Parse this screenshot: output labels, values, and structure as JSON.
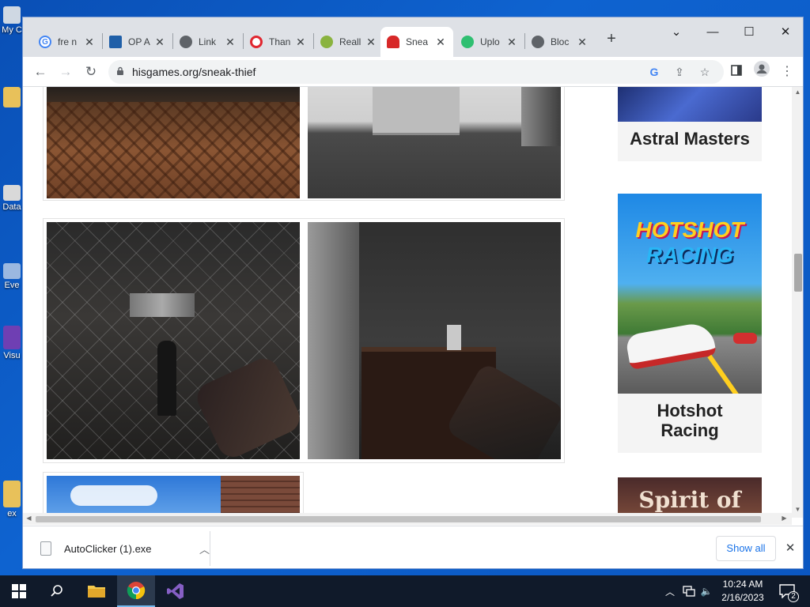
{
  "desktop": {
    "icons": [
      {
        "label": "My C",
        "color": "#cfd8e3"
      },
      {
        "label": "",
        "color": "#e8c15a"
      },
      {
        "label": "Data",
        "color": "#d9d9d9"
      },
      {
        "label": "Eve",
        "color": "#9bb8e0"
      },
      {
        "label": "Visu",
        "color": "#6f3fb3"
      },
      {
        "label": "ex",
        "color": "#e8c15a"
      }
    ]
  },
  "browser": {
    "tabs": [
      {
        "title": "fre n",
        "icon": "google-icon",
        "color": "#4285f4"
      },
      {
        "title": "OP A",
        "icon": "document-icon",
        "color": "#1f5fa8"
      },
      {
        "title": "Link",
        "icon": "globe-icon",
        "color": "#5f6368"
      },
      {
        "title": "Than",
        "icon": "opera-icon",
        "color": "#e0262f"
      },
      {
        "title": "Reall",
        "icon": "leaf-icon",
        "color": "#8ab33f"
      },
      {
        "title": "Snea",
        "icon": "ghost-icon",
        "color": "#d72828",
        "active": true
      },
      {
        "title": "Uplo",
        "icon": "upload-icon",
        "color": "#2fbf71"
      },
      {
        "title": "Bloc",
        "icon": "globe-icon",
        "color": "#5f6368"
      }
    ],
    "window_controls": {
      "tab_search": "⌄",
      "minimize": "—",
      "maximize": "☐",
      "close": "✕"
    },
    "new_tab": "+",
    "nav": {
      "back": "←",
      "forward": "→",
      "reload": "↻"
    },
    "url": "hisgames.org/sneak-thief",
    "lock_icon": "lock-icon",
    "toolbar_icons": [
      "google-lens-icon",
      "share-icon",
      "bookmark-star-icon",
      "side-panel-icon",
      "profile-icon",
      "menu-icon"
    ]
  },
  "page": {
    "promos": [
      {
        "title": "Astral Masters"
      },
      {
        "title": "Hotshot Racing",
        "logo_line1": "HOTSHOT",
        "logo_line2": "RACING"
      },
      {
        "title": "",
        "logo": "Spirit of"
      }
    ],
    "screenshots": [
      "warehouse-floor",
      "white-room",
      "fence-corridor",
      "office-counter",
      "sky-building"
    ]
  },
  "downloads": {
    "file": "AutoClicker (1).exe",
    "show_all": "Show all"
  },
  "taskbar": {
    "time": "10:24 AM",
    "date": "2/16/2023",
    "notification_count": "2"
  }
}
